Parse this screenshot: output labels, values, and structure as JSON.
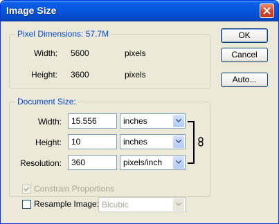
{
  "window": {
    "title": "Image Size"
  },
  "pixel_dimensions": {
    "legend": "Pixel Dimensions:",
    "size": "57.7M",
    "width_label": "Width:",
    "width_value": "5600",
    "width_unit": "pixels",
    "height_label": "Height:",
    "height_value": "3600",
    "height_unit": "pixels"
  },
  "document_size": {
    "legend": "Document Size:",
    "width_label": "Width:",
    "width_value": "15.556",
    "width_unit": "inches",
    "height_label": "Height:",
    "height_value": "10",
    "height_unit": "inches",
    "resolution_label": "Resolution:",
    "resolution_value": "360",
    "resolution_unit": "pixels/inch"
  },
  "buttons": {
    "ok": "OK",
    "cancel": "Cancel",
    "auto": "Auto..."
  },
  "options": {
    "constrain_label": "Constrain Proportions",
    "constrain_checked": true,
    "resample_label": "Resample Image:",
    "resample_checked": false,
    "resample_method": "Bicubic"
  },
  "colors": {
    "titlebar": "#0a5ee8",
    "legend_text": "#0046d5",
    "dialog_bg": "#ece9d8"
  }
}
